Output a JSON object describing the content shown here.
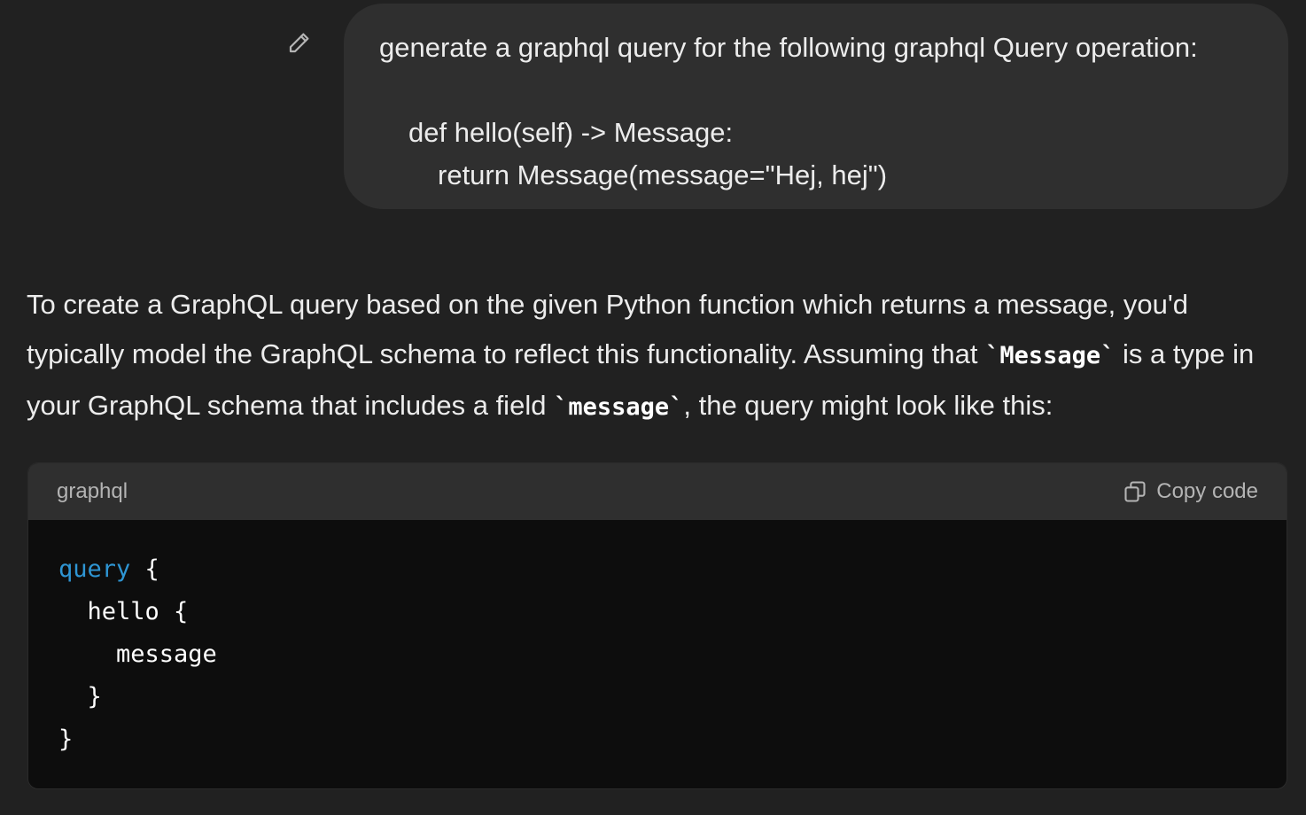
{
  "user_message": {
    "lines": [
      "generate a graphql query for the following graphql Query operation:",
      "",
      "def hello(self) -> Message:",
      "return Message(message=\"Hej, hej\")"
    ]
  },
  "edit_icon": "pencil-icon",
  "assistant": {
    "paragraph": {
      "part1": "To create a GraphQL query based on the given Python function which returns a message, you'd typically model the GraphQL schema to reflect this functionality. Assuming that ",
      "code1": "`Message`",
      "part2": " is a type in your GraphQL schema that includes a field ",
      "code2": "`message`",
      "part3": ", the query might look like this:"
    }
  },
  "code_block": {
    "language": "graphql",
    "copy_label": "Copy code",
    "copy_icon": "copy-icon",
    "keyword_color": "#2e95d3",
    "lines": {
      "l1_keyword": "query",
      "l1_rest": " {",
      "l2": "  hello {",
      "l3": "    message",
      "l4": "  }",
      "l5": "}"
    }
  },
  "colors": {
    "background": "#212121",
    "bubble": "#2f2f2f",
    "code_bg": "#0d0d0d",
    "code_header": "#2f2f2f",
    "text": "#ececec",
    "muted": "#b4b4b4"
  }
}
